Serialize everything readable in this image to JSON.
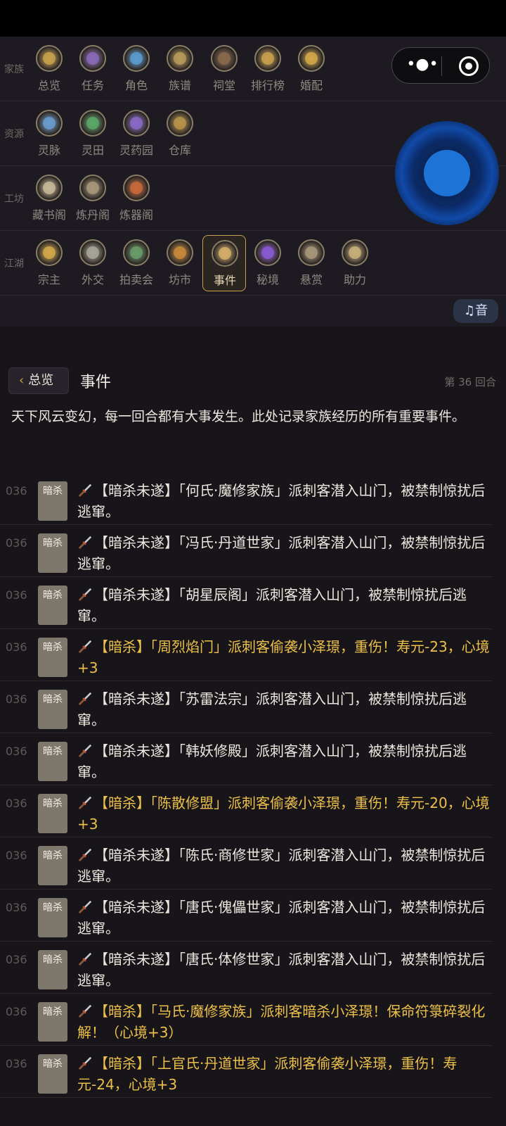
{
  "top_panel": {
    "rows": [
      {
        "label": "家族",
        "items": [
          {
            "label": "总览",
            "icon": "overview-medal-icon",
            "color": "#c9a04e"
          },
          {
            "label": "任务",
            "icon": "task-medal-icon",
            "color": "#8a6ab8"
          },
          {
            "label": "角色",
            "icon": "character-medal-icon",
            "color": "#5a9ccf"
          },
          {
            "label": "族谱",
            "icon": "family-tree-medal-icon",
            "color": "#b89a5a"
          },
          {
            "label": "祠堂",
            "icon": "ancestral-hall-medal-icon",
            "color": "#8a6a4e"
          },
          {
            "label": "排行榜",
            "icon": "ranking-medal-icon",
            "color": "#c9a04e"
          },
          {
            "label": "婚配",
            "icon": "marriage-medal-icon",
            "color": "#d4a84a"
          }
        ]
      },
      {
        "label": "资源",
        "items": [
          {
            "label": "灵脉",
            "icon": "spirit-vein-medal-icon",
            "color": "#6a9ccf"
          },
          {
            "label": "灵田",
            "icon": "spirit-field-medal-icon",
            "color": "#5aa86a"
          },
          {
            "label": "灵药园",
            "icon": "herb-garden-medal-icon",
            "color": "#8a6ac8"
          },
          {
            "label": "仓库",
            "icon": "warehouse-medal-icon",
            "color": "#b8944a"
          }
        ]
      },
      {
        "label": "工坊",
        "items": [
          {
            "label": "藏书阁",
            "icon": "library-medal-icon",
            "color": "#c8b89a"
          },
          {
            "label": "炼丹阁",
            "icon": "alchemy-medal-icon",
            "color": "#a8987a"
          },
          {
            "label": "炼器阁",
            "icon": "forge-medal-icon",
            "color": "#c86a3a"
          }
        ]
      },
      {
        "label": "江湖",
        "items": [
          {
            "label": "宗主",
            "icon": "sect-leader-medal-icon",
            "color": "#d4a84a"
          },
          {
            "label": "外交",
            "icon": "diplomacy-medal-icon",
            "color": "#a8a89a"
          },
          {
            "label": "拍卖会",
            "icon": "auction-medal-icon",
            "color": "#6a9c6a"
          },
          {
            "label": "坊市",
            "icon": "market-medal-icon",
            "color": "#c88a3a"
          },
          {
            "label": "事件",
            "icon": "event-medal-icon",
            "color": "#d4b06a",
            "active": true
          },
          {
            "label": "秘境",
            "icon": "secret-realm-medal-icon",
            "color": "#8a5ad4"
          },
          {
            "label": "悬赏",
            "icon": "bounty-medal-icon",
            "color": "#a8987a"
          },
          {
            "label": "助力",
            "icon": "assist-medal-icon",
            "color": "#c8b07a"
          }
        ]
      }
    ],
    "music_label": "音",
    "music_icon": "music-note-icon"
  },
  "header": {
    "back_label": "总览",
    "title": "事件",
    "turn_text": "第 36 回合"
  },
  "intro": "天下风云变幻，每一回合都有大事发生。此处记录家族经历的所有重要事件。",
  "events": [
    {
      "turn": "036",
      "tag": "暗杀",
      "text": "【暗杀未遂】「何氏·魔修家族」派刺客潜入山门，被禁制惊扰后逃窜。",
      "highlight": false
    },
    {
      "turn": "036",
      "tag": "暗杀",
      "text": "【暗杀未遂】「冯氏·丹道世家」派刺客潜入山门，被禁制惊扰后逃窜。",
      "highlight": false
    },
    {
      "turn": "036",
      "tag": "暗杀",
      "text": "【暗杀未遂】「胡星辰阁」派刺客潜入山门，被禁制惊扰后逃窜。",
      "highlight": false
    },
    {
      "turn": "036",
      "tag": "暗杀",
      "text": "【暗杀】「周烈焰门」派刺客偷袭小泽璟，重伤！寿元-23，心境+3",
      "highlight": true
    },
    {
      "turn": "036",
      "tag": "暗杀",
      "text": "【暗杀未遂】「苏雷法宗」派刺客潜入山门，被禁制惊扰后逃窜。",
      "highlight": false
    },
    {
      "turn": "036",
      "tag": "暗杀",
      "text": "【暗杀未遂】「韩妖修殿」派刺客潜入山门，被禁制惊扰后逃窜。",
      "highlight": false
    },
    {
      "turn": "036",
      "tag": "暗杀",
      "text": "【暗杀】「陈散修盟」派刺客偷袭小泽璟，重伤！寿元-20，心境+3",
      "highlight": true
    },
    {
      "turn": "036",
      "tag": "暗杀",
      "text": "【暗杀未遂】「陈氏·商修世家」派刺客潜入山门，被禁制惊扰后逃窜。",
      "highlight": false
    },
    {
      "turn": "036",
      "tag": "暗杀",
      "text": "【暗杀未遂】「唐氏·傀儡世家」派刺客潜入山门，被禁制惊扰后逃窜。",
      "highlight": false
    },
    {
      "turn": "036",
      "tag": "暗杀",
      "text": "【暗杀未遂】「唐氏·体修世家」派刺客潜入山门，被禁制惊扰后逃窜。",
      "highlight": false
    },
    {
      "turn": "036",
      "tag": "暗杀",
      "text": "【暗杀】「马氏·魔修家族」派刺客暗杀小泽璟！保命符箓碎裂化解！（心境+3）",
      "highlight": true
    },
    {
      "turn": "036",
      "tag": "暗杀",
      "text": "【暗杀】「上官氏·丹道世家」派刺客偷袭小泽璟，重伤！寿元-24，心境+3",
      "highlight": true
    }
  ],
  "colors": {
    "accent_gold": "#c9a04e",
    "highlight_text": "#ecc04a",
    "tag_bg": "#7e776c",
    "joystick": "#1d73d6"
  }
}
